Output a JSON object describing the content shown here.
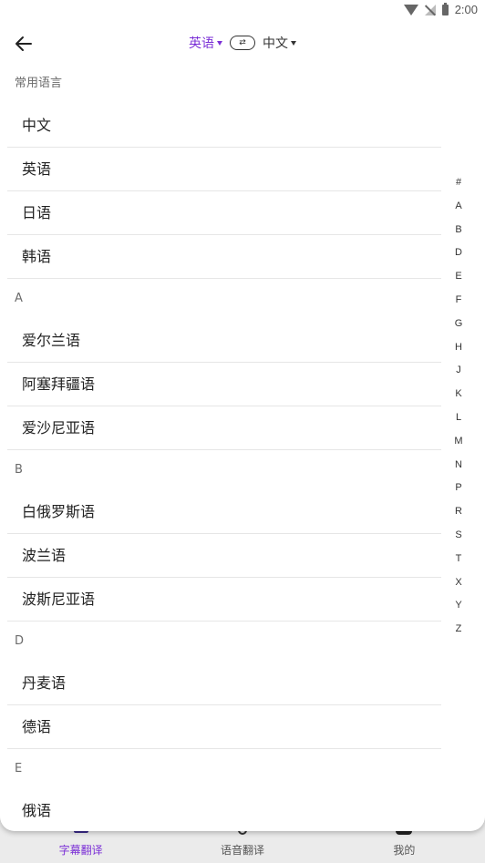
{
  "status_bar": {
    "time": "2:00"
  },
  "header": {
    "source_lang": "英语",
    "target_lang": "中文",
    "swap_label": "⇄"
  },
  "sections": [
    {
      "title": "常用语言",
      "items": [
        "中文",
        "英语",
        "日语",
        "韩语"
      ]
    },
    {
      "title": "A",
      "items": [
        "爱尔兰语",
        "阿塞拜疆语",
        "爱沙尼亚语"
      ]
    },
    {
      "title": "B",
      "items": [
        "白俄罗斯语",
        "波兰语",
        "波斯尼亚语"
      ]
    },
    {
      "title": "D",
      "items": [
        "丹麦语",
        "德语"
      ]
    },
    {
      "title": "E",
      "items": [
        "俄语"
      ]
    }
  ],
  "index_letters": [
    "#",
    "A",
    "B",
    "D",
    "E",
    "F",
    "G",
    "H",
    "J",
    "K",
    "L",
    "M",
    "N",
    "P",
    "R",
    "S",
    "T",
    "X",
    "Y",
    "Z"
  ],
  "tabs": [
    {
      "label": "字幕翻译",
      "icon": "subtitle-icon",
      "active": true
    },
    {
      "label": "语音翻译",
      "icon": "microphone-icon",
      "active": false
    },
    {
      "label": "我的",
      "icon": "user-icon",
      "active": false
    }
  ],
  "colors": {
    "accent": "#7b2fd6",
    "divider": "#e6e6e6",
    "tabbar": "#ebebeb"
  }
}
